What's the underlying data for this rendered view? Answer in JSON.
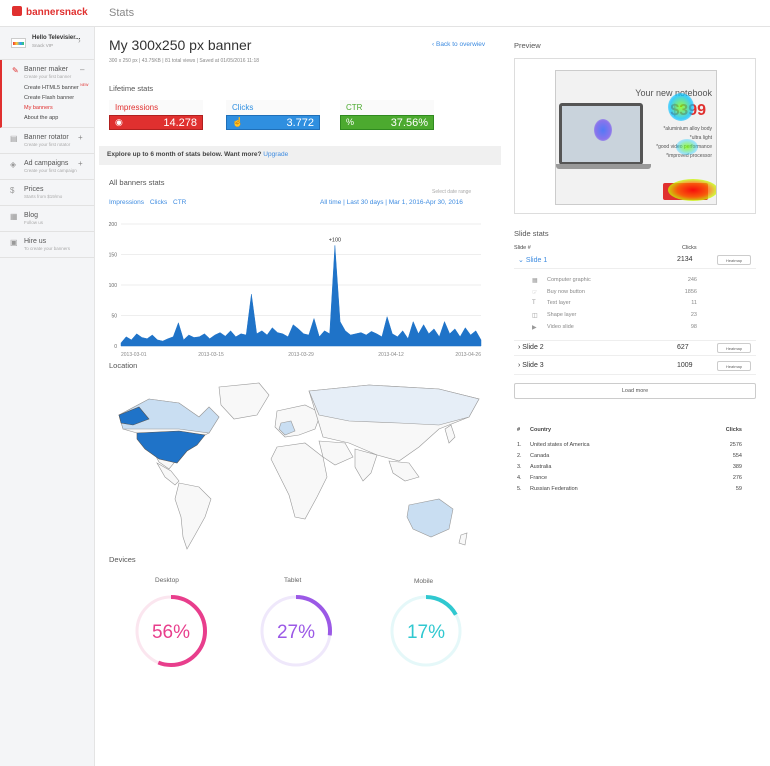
{
  "app": {
    "logo": "bannersnack",
    "page": "Stats"
  },
  "user": {
    "name": "Hello Televisier...",
    "plan": "Snack VIP"
  },
  "nav": [
    {
      "title": "Banner maker",
      "sub": "Create your first banner",
      "icon": "pencil-icon",
      "toggle": "–",
      "children": [
        "Create HTML5 banner",
        "Create Flash banner",
        "My banners",
        "About the app"
      ]
    },
    {
      "title": "Banner rotator",
      "sub": "Create your first rotator",
      "icon": "rotator-icon",
      "toggle": "+"
    },
    {
      "title": "Ad campaigns",
      "sub": "Create your first campaign",
      "icon": "campaign-icon",
      "toggle": "+"
    },
    {
      "title": "Prices",
      "sub": "Starts from $19/mo",
      "icon": "dollar-icon"
    },
    {
      "title": "Blog",
      "sub": "Follow us",
      "icon": "blog-icon"
    },
    {
      "title": "Hire us",
      "sub": "To create your banners",
      "icon": "hire-icon"
    }
  ],
  "banner": {
    "title": "My 300x250 px banner",
    "meta": "300 x 250 px  |  43.75KB  |  81 total views  |  Saved at 01/05/2016 11:18",
    "back": "Back to overwiev"
  },
  "lifetime": {
    "label": "Lifetime stats",
    "items": [
      {
        "label": "Impressions",
        "value": "14.278",
        "color": "#e0302f",
        "icon": "eye-icon"
      },
      {
        "label": "Clicks",
        "value": "3.772",
        "color": "#2f8fe0",
        "icon": "click-icon"
      },
      {
        "label": "CTR",
        "value": "37.56%",
        "color": "#4caa2f",
        "icon": "percent-icon"
      }
    ]
  },
  "promo": {
    "text": "Explore up to 6 month of stats below. Want more?",
    "link": "Upgrade"
  },
  "all_stats": {
    "label": "All banners stats",
    "tabs": [
      "Impressions",
      "Clicks",
      "CTR"
    ],
    "range_label": "Select date range",
    "ranges": "All time  |  Last 30 days  |  Mar 1, 2016-Apr 30, 2016"
  },
  "chart_data": {
    "type": "area",
    "x": [
      "2013-03-01",
      "2013-03-02",
      "2013-03-03",
      "2013-03-04",
      "2013-03-05",
      "2013-03-06",
      "2013-03-07",
      "2013-03-08",
      "2013-03-09",
      "2013-03-10",
      "2013-03-11",
      "2013-03-12",
      "2013-03-13",
      "2013-03-14",
      "2013-03-15",
      "2013-03-16",
      "2013-03-17",
      "2013-03-18",
      "2013-03-19",
      "2013-03-20",
      "2013-03-21",
      "2013-03-22",
      "2013-03-23",
      "2013-03-24",
      "2013-03-25",
      "2013-03-26",
      "2013-03-27",
      "2013-03-28",
      "2013-03-29",
      "2013-03-30",
      "2013-03-31",
      "2013-04-01",
      "2013-04-02",
      "2013-04-03",
      "2013-04-04",
      "2013-04-05",
      "2013-04-06",
      "2013-04-07",
      "2013-04-08",
      "2013-04-09",
      "2013-04-10",
      "2013-04-11",
      "2013-04-12",
      "2013-04-13",
      "2013-04-14",
      "2013-04-15",
      "2013-04-16",
      "2013-04-17",
      "2013-04-18",
      "2013-04-19",
      "2013-04-20",
      "2013-04-21",
      "2013-04-22",
      "2013-04-23",
      "2013-04-24",
      "2013-04-25",
      "2013-04-26"
    ],
    "values": [
      5,
      15,
      10,
      20,
      14,
      12,
      18,
      10,
      8,
      12,
      15,
      38,
      10,
      18,
      14,
      15,
      20,
      12,
      18,
      22,
      16,
      25,
      15,
      20,
      18,
      85,
      20,
      25,
      18,
      30,
      22,
      20,
      15,
      35,
      28,
      20,
      18,
      45,
      15,
      25,
      20,
      165,
      40,
      25,
      18,
      20,
      22,
      18,
      24,
      20,
      15,
      48,
      20,
      15,
      25,
      12,
      40,
      20,
      35,
      20,
      28,
      15,
      40,
      20,
      28,
      15,
      30,
      18,
      25,
      10
    ],
    "xticks": [
      "2013-03-01",
      "2013-03-15",
      "2013-03-29",
      "2013-04-12",
      "2013-04-26"
    ],
    "yticks": [
      0,
      50,
      100,
      150,
      200
    ],
    "ylim": [
      0,
      200
    ],
    "annotation": "+100",
    "color": "#1f73c8"
  },
  "location": {
    "label": "Location"
  },
  "devices": {
    "label": "Devices",
    "items": [
      {
        "name": "Desktop",
        "pct": 56,
        "label": "56%",
        "color": "#e83e8c"
      },
      {
        "name": "Tablet",
        "pct": 27,
        "label": "27%",
        "color": "#9b59e6"
      },
      {
        "name": "Mobile",
        "pct": 17,
        "label": "17%",
        "color": "#30c8d0"
      }
    ]
  },
  "preview": {
    "label": "Preview",
    "headline": "Your new notebook",
    "price": "$399",
    "features": [
      "*aluminium alloy body",
      "*ultra light",
      "*good video performance",
      "*improved processor"
    ]
  },
  "slides": {
    "label": "Slide stats",
    "col_slide": "Slide #",
    "col_clicks": "Clicks",
    "heatmap": "Heatmap",
    "rows": [
      {
        "name": "Slide 1",
        "clicks": "2134"
      },
      {
        "name": "Slide 2",
        "clicks": "627"
      },
      {
        "name": "Slide 3",
        "clicks": "1009"
      }
    ],
    "layers": [
      {
        "icon": "image-icon",
        "name": "Computer graphic",
        "clicks": "246"
      },
      {
        "icon": "button-icon",
        "name": "Buy now button",
        "clicks": "1856"
      },
      {
        "icon": "text-icon",
        "name": "Text layer",
        "clicks": "11"
      },
      {
        "icon": "shape-icon",
        "name": "Shape layer",
        "clicks": "23"
      },
      {
        "icon": "video-icon",
        "name": "Video slide",
        "clicks": "98"
      }
    ],
    "load_more": "Load more"
  },
  "countries": {
    "col_num": "#",
    "col_country": "Country",
    "col_clicks": "Clicks",
    "rows": [
      {
        "n": "1.",
        "name": "United states of America",
        "clicks": "2576"
      },
      {
        "n": "2.",
        "name": "Canada",
        "clicks": "554"
      },
      {
        "n": "3.",
        "name": "Australia",
        "clicks": "389"
      },
      {
        "n": "4.",
        "name": "France",
        "clicks": "276"
      },
      {
        "n": "5.",
        "name": "Russian Federation",
        "clicks": "59"
      }
    ]
  }
}
